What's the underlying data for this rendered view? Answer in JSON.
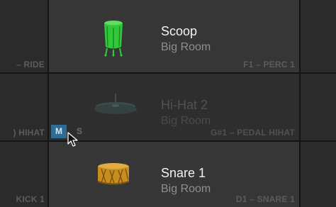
{
  "pads": [
    {
      "name": "Scoop",
      "kit": "Big Room",
      "note": "F1 – PERC 1",
      "icon": "conga-drum-icon",
      "color": "#2fc93a",
      "muted": false
    },
    {
      "name": "Hi-Hat 2",
      "kit": "Big Room",
      "note": "G#1 – PEDAL HIHAT",
      "icon": "hihat-cymbal-icon",
      "color": "#3b4a4a",
      "muted": true
    },
    {
      "name": "Snare 1",
      "kit": "Big Room",
      "note": "D1 – SNARE 1",
      "icon": "snare-drum-icon",
      "color": "#c98c1e",
      "muted": false
    }
  ],
  "left_column": [
    "– RIDE",
    ") HIHAT",
    "KICK 1"
  ],
  "mute_label": "M",
  "solo_label": "S",
  "colors": {
    "mute_active": "#2f6c94",
    "background": "#141414"
  }
}
